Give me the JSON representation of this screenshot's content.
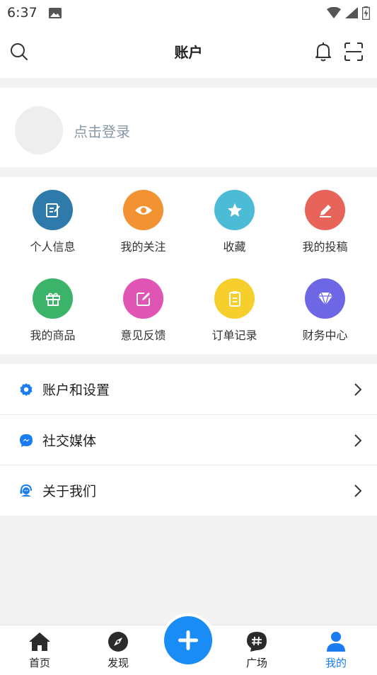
{
  "status": {
    "time": "6:37"
  },
  "header": {
    "title": "账户"
  },
  "login": {
    "prompt": "点击登录"
  },
  "grid": {
    "items": [
      {
        "label": "个人信息",
        "icon": "edit-note-icon",
        "color": "#2e7bab"
      },
      {
        "label": "我的关注",
        "icon": "eye-icon",
        "color": "#f39232"
      },
      {
        "label": "收藏",
        "icon": "star-icon",
        "color": "#4cbcd6"
      },
      {
        "label": "我的投稿",
        "icon": "pencil-icon",
        "color": "#e8645a"
      },
      {
        "label": "我的商品",
        "icon": "gift-icon",
        "color": "#3bb46a"
      },
      {
        "label": "意见反馈",
        "icon": "compose-icon",
        "color": "#e055b3"
      },
      {
        "label": "订单记录",
        "icon": "clipboard-icon",
        "color": "#f7cf2d"
      },
      {
        "label": "财务中心",
        "icon": "diamond-icon",
        "color": "#6d67e6"
      }
    ]
  },
  "menu": {
    "items": [
      {
        "label": "账户和设置",
        "icon": "gear-icon"
      },
      {
        "label": "社交媒体",
        "icon": "messenger-icon"
      },
      {
        "label": "关于我们",
        "icon": "support-agent-icon"
      }
    ]
  },
  "tabs": {
    "items": [
      {
        "label": "首页",
        "icon": "home-icon"
      },
      {
        "label": "发现",
        "icon": "compass-icon"
      },
      {
        "label": "广场",
        "icon": "hashtag-icon"
      },
      {
        "label": "我的",
        "icon": "person-icon"
      }
    ],
    "active_index": 3
  },
  "colors": {
    "accent": "#1a8cf5",
    "active_tab": "#1a7cf1",
    "menu_icon": "#1a7cf1"
  }
}
